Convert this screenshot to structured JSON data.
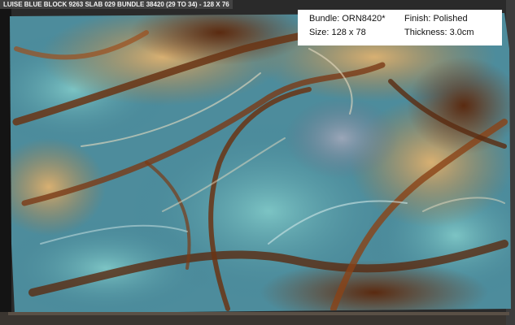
{
  "caption": "LUISE BLUE BLOCK 9263 SLAB 029 BUNDLE 38420 (29 TO 34) - 128 X 76",
  "info": {
    "bundle": "Bundle: ORN8420*",
    "size": "Size: 128 x 78",
    "finish": "Finish: Polished",
    "thickness": "Thickness: 3.0cm"
  },
  "colors": {
    "blue": "#4f94a6",
    "turquoise": "#6db8b4",
    "brown": "#6a3414",
    "rust": "#9c4f1c",
    "gold": "#c9a062",
    "cream": "#e8dcc2",
    "grey": "#8a92a2"
  }
}
